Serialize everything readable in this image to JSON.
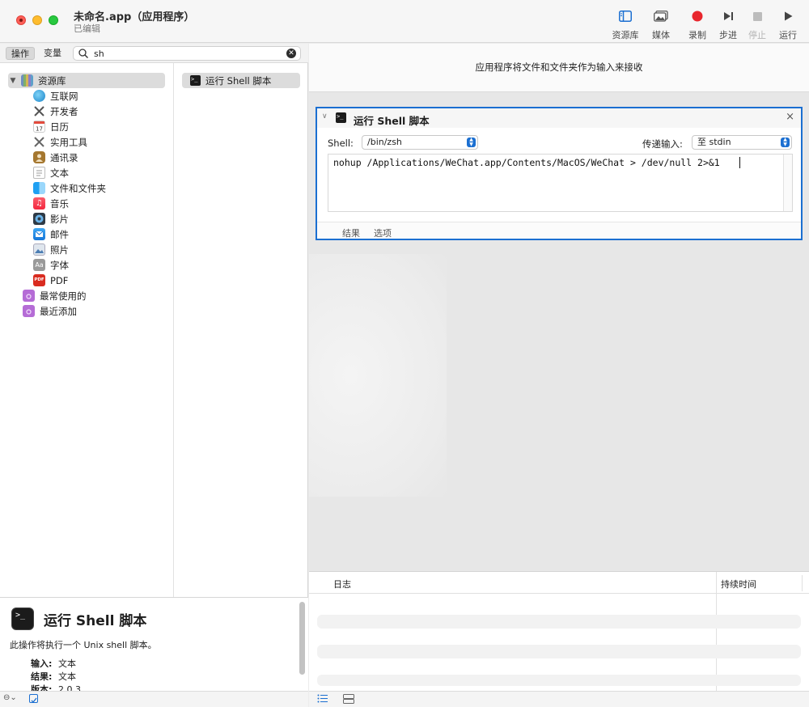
{
  "window": {
    "title": "未命名.app（应用程序）",
    "subtitle": "已编辑"
  },
  "toolbar": {
    "library": "资源库",
    "media": "媒体",
    "record": "录制",
    "step": "步进",
    "stop": "停止",
    "run": "运行"
  },
  "left_toolbar": {
    "actions_tab": "操作",
    "variables_tab": "变量",
    "search_value": "sh"
  },
  "library": {
    "root": "资源库",
    "items": [
      {
        "label": "互联网",
        "icon": "globe-icon"
      },
      {
        "label": "开发者",
        "icon": "developer-tools-icon"
      },
      {
        "label": "日历",
        "icon": "calendar-icon"
      },
      {
        "label": "实用工具",
        "icon": "utilities-icon"
      },
      {
        "label": "通讯录",
        "icon": "contacts-icon"
      },
      {
        "label": "文本",
        "icon": "text-document-icon"
      },
      {
        "label": "文件和文件夹",
        "icon": "finder-icon"
      },
      {
        "label": "音乐",
        "icon": "music-icon"
      },
      {
        "label": "影片",
        "icon": "movie-icon"
      },
      {
        "label": "邮件",
        "icon": "mail-icon"
      },
      {
        "label": "照片",
        "icon": "photos-icon"
      },
      {
        "label": "字体",
        "icon": "fonts-icon"
      },
      {
        "label": "PDF",
        "icon": "pdf-icon"
      }
    ],
    "smart_groups": [
      {
        "label": "最常使用的",
        "icon": "smart-folder-icon"
      },
      {
        "label": "最近添加",
        "icon": "smart-folder-icon"
      }
    ]
  },
  "actions_list": [
    {
      "label": "运行 Shell 脚本",
      "icon": "terminal-icon"
    }
  ],
  "description": {
    "title": "运行 Shell 脚本",
    "text": "此操作将执行一个 Unix shell 脚本。",
    "input_label": "输入:",
    "input_value": "文本",
    "result_label": "结果:",
    "result_value": "文本",
    "version_label": "版本:",
    "version_value": "2.0.3"
  },
  "workflow": {
    "receives_text": "应用程序将文件和文件夹作为输入来接收",
    "action": {
      "title": "运行 Shell 脚本",
      "shell_label": "Shell:",
      "shell_value": "/bin/zsh",
      "pass_input_label": "传递输入:",
      "pass_input_value": "至 stdin",
      "script": "nohup /Applications/WeChat.app/Contents/MacOS/WeChat > /dev/null 2>&1",
      "tab_results": "结果",
      "tab_options": "选项"
    }
  },
  "log": {
    "col_log": "日志",
    "col_duration": "持续时间"
  },
  "colors": {
    "accent": "#1b6fd1",
    "close": "#ff5f57",
    "minimize": "#febc2e",
    "maximize": "#28c840",
    "record": "#e8262d"
  }
}
